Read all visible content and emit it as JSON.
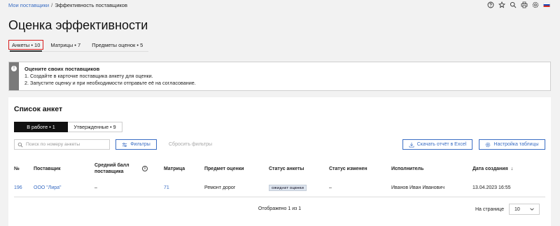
{
  "breadcrumb": {
    "root": "Мои поставщики",
    "separator": "/",
    "current": "Эффективность поставщиков"
  },
  "top_icons": [
    "help-icon",
    "star-icon",
    "search-icon",
    "print-icon",
    "settings-icon",
    "flag-ru-icon"
  ],
  "page_title": "Оценка эффективности",
  "tabs": [
    {
      "label": "Анкеты • 10",
      "active": true
    },
    {
      "label": "Матрицы • 7",
      "active": false
    },
    {
      "label": "Предметы оценок • 5",
      "active": false
    }
  ],
  "notice": {
    "title": "Оцените своих поставщиков",
    "lines": [
      "1. Создайте в карточке поставщика анкету для оценки.",
      "2. Запустите оценку и при необходимости отправьте её на согласование."
    ]
  },
  "list": {
    "title": "Список анкет",
    "segments": [
      {
        "label": "В работе • 1",
        "active": true
      },
      {
        "label": "Утвержденные • 9",
        "active": false
      }
    ],
    "search_placeholder": "Поиск по номеру анкеты",
    "filters_label": "Фильтры",
    "reset_label": "Сбросить фильтры",
    "excel_label": "Скачать отчёт в Excel",
    "settings_label": "Настройка таблицы",
    "columns": {
      "num": "№",
      "supplier": "Поставщик",
      "score": "Средний балл поставщика",
      "matrix": "Матрица",
      "subject": "Предмет оценки",
      "status": "Статус анкеты",
      "status_changed": "Статус изменен",
      "executor": "Исполнитель",
      "created": "Дата создания"
    },
    "rows": [
      {
        "num": "196",
        "supplier": "ООО \"Лира\"",
        "score": "–",
        "matrix": "71",
        "subject": "Ремонт дорог",
        "status": "ОЖИДАЕТ ОЦЕНКИ",
        "status_changed": "–",
        "executor": "Иванов Иван Иванович",
        "created": "13.04.2023 16:55"
      }
    ],
    "shown": "Отображено 1 из 1",
    "per_page_label": "На странице",
    "per_page_value": "10"
  },
  "colors": {
    "accent": "#3b6ec4",
    "highlight": "#d81e1e",
    "notice_bar": "#7a7a7a"
  }
}
